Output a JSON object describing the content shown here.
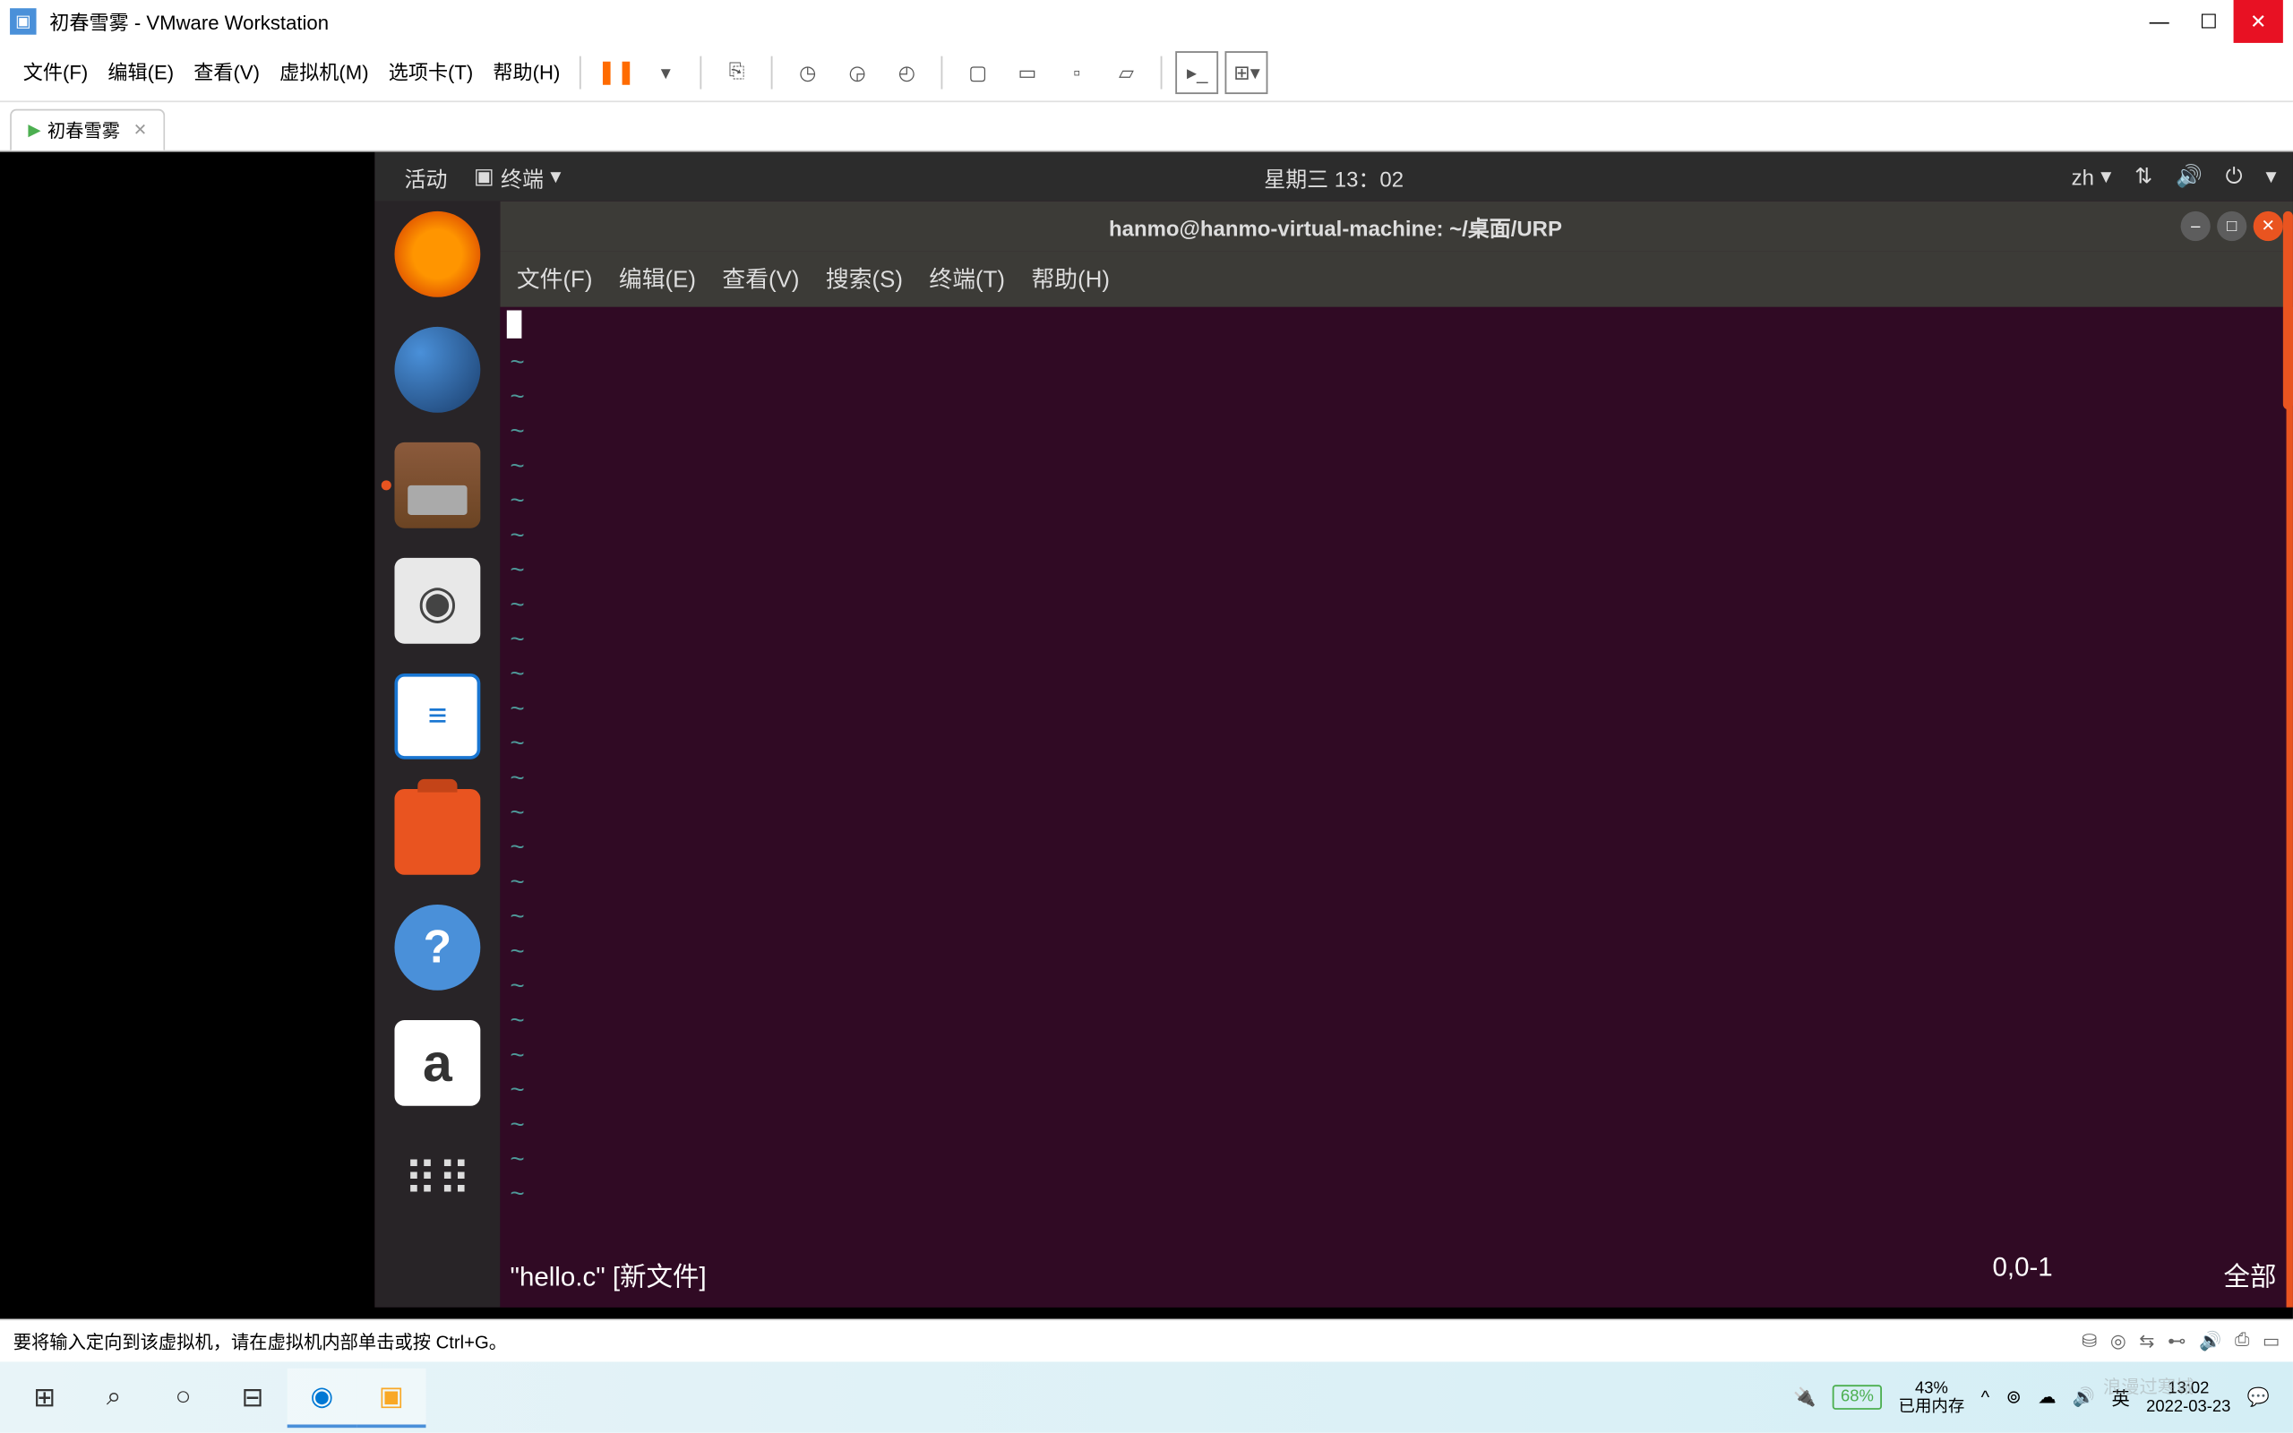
{
  "window": {
    "title": "初春雪雾 - VMware Workstation",
    "tab_name": "初春雪雾"
  },
  "vmware_menu": {
    "file": "文件(F)",
    "edit": "编辑(E)",
    "view": "查看(V)",
    "vm": "虚拟机(M)",
    "tabs": "选项卡(T)",
    "help": "帮助(H)"
  },
  "ubuntu": {
    "activities": "活动",
    "app_name": "终端",
    "datetime": "星期三 13：02",
    "lang": "zh"
  },
  "terminal": {
    "title": "hanmo@hanmo-virtual-machine: ~/桌面/URP",
    "menu": {
      "file": "文件(F)",
      "edit": "编辑(E)",
      "view": "查看(V)",
      "search": "搜索(S)",
      "terminal": "终端(T)",
      "help": "帮助(H)"
    },
    "status": {
      "filename": "\"hello.c\" [新文件]",
      "position": "0,0-1",
      "all": "全部"
    }
  },
  "vmware_status": {
    "message": "要将输入定向到该虚拟机，请在虚拟机内部单击或按 Ctrl+G。"
  },
  "taskbar": {
    "battery": "68%",
    "memory_pct": "43%",
    "memory_label": "已用内存",
    "ime": "英",
    "time": "13:02",
    "date": "2022-03-23",
    "watermark": "浪漫过寒城"
  }
}
